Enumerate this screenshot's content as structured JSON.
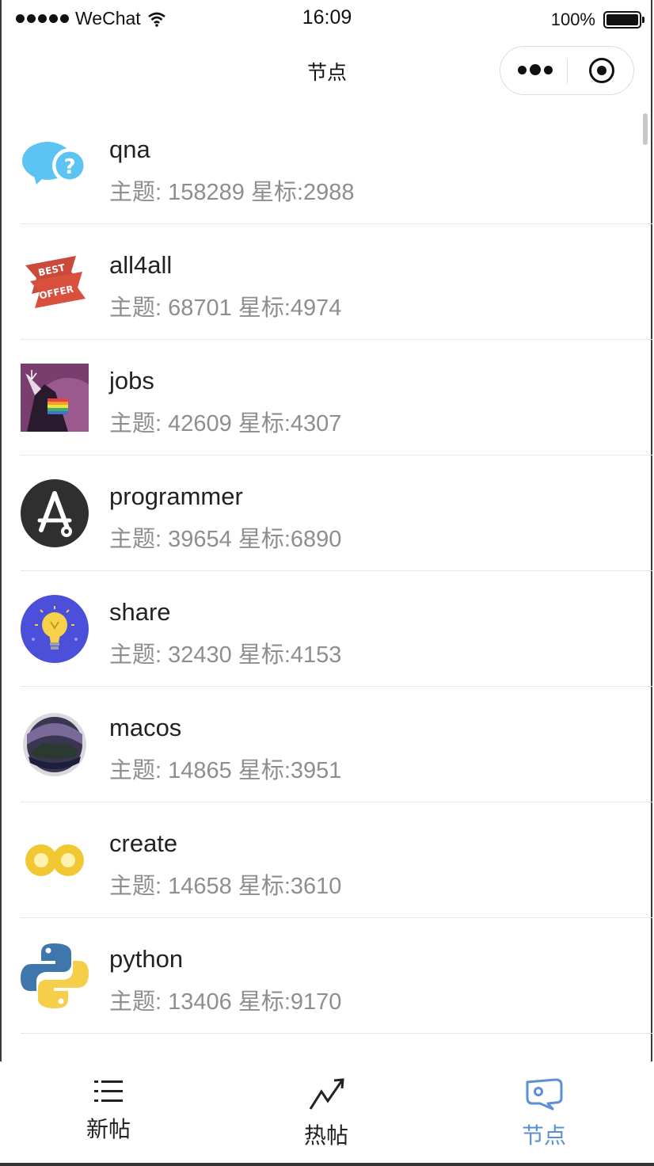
{
  "status_bar": {
    "carrier": "WeChat",
    "time": "16:09",
    "battery": "100%"
  },
  "nav": {
    "title": "节点"
  },
  "nodes": [
    {
      "name": "qna",
      "stats": "主题: 158289 星标:2988",
      "icon": "question-bubble-icon"
    },
    {
      "name": "all4all",
      "stats": "主题: 68701 星标:4974",
      "icon": "best-offer-icon"
    },
    {
      "name": "jobs",
      "stats": "主题: 42609 星标:4307",
      "icon": "unicorn-icon"
    },
    {
      "name": "programmer",
      "stats": "主题: 39654 星标:6890",
      "icon": "app-store-icon"
    },
    {
      "name": "share",
      "stats": "主题: 32430 星标:4153",
      "icon": "lightbulb-icon"
    },
    {
      "name": "macos",
      "stats": "主题: 14865 星标:3951",
      "icon": "macos-icon"
    },
    {
      "name": "create",
      "stats": "主题: 14658 星标:3610",
      "icon": "infinity-icon"
    },
    {
      "name": "python",
      "stats": "主题: 13406 星标:9170",
      "icon": "python-icon"
    }
  ],
  "tabs": [
    {
      "label": "新帖",
      "icon": "list-icon",
      "active": false
    },
    {
      "label": "热帖",
      "icon": "trend-icon",
      "active": false
    },
    {
      "label": "节点",
      "icon": "tag-icon",
      "active": true
    }
  ],
  "colors": {
    "active_tab": "#5b8fd6",
    "stats_text": "#8e8e8e"
  }
}
